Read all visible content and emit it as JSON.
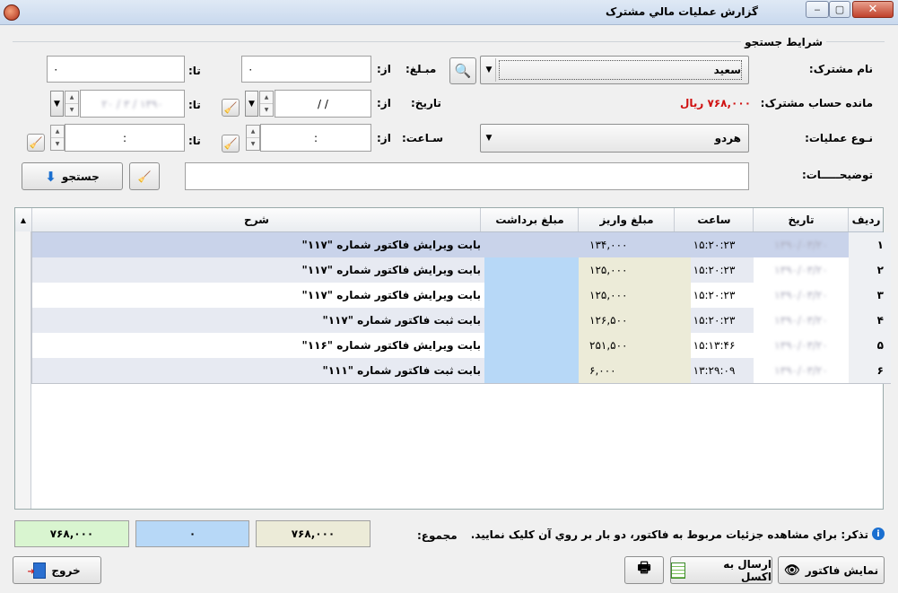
{
  "window": {
    "title": "گزارش عمليات مالي مشترک",
    "min": "‒",
    "restore": "▢",
    "close": "✕"
  },
  "search": {
    "group_title": "شرايط جستجو",
    "customer_label": "نام مشترک:",
    "customer_value": "سعيد",
    "balance_label": "مانده حساب مشترک:",
    "balance_value": "۷۶۸,۰۰۰ ريال",
    "optype_label": "نـوع عمليات:",
    "optype_value": "هردو",
    "desc_label": "توضيحـــــات:",
    "amount_label": "مبـلغ:",
    "from_label": "از:",
    "to_label": "تا:",
    "amount_from": "۰",
    "amount_to": "۰",
    "date_label": "تاريخ:",
    "date_from": "/   /",
    "date_to": "۱۳۹۰ / ۳ / ۲۰",
    "time_label": "سـاعت:",
    "time_from": ":",
    "time_to": ":",
    "search_button": "جستجو",
    "colors": {
      "balance": "#d01010"
    }
  },
  "table": {
    "headers": [
      "رديف",
      "تاريخ",
      "ساعت",
      "مبلغ واريز",
      "مبلغ برداشت",
      "شرح"
    ],
    "rows": [
      {
        "n": "۱",
        "date": "۱۳۹۰/۰۳/۲۰",
        "time": "۱۵:۲۰:۲۳",
        "deposit": "۱۳۴,۰۰۰",
        "withdraw": "",
        "desc": "بابت ويرايش فاکتور شماره \"۱۱۷\""
      },
      {
        "n": "۲",
        "date": "۱۳۹۰/۰۳/۲۰",
        "time": "۱۵:۲۰:۲۳",
        "deposit": "۱۲۵,۰۰۰",
        "withdraw": "",
        "desc": "بابت ويرايش فاکتور شماره \"۱۱۷\""
      },
      {
        "n": "۳",
        "date": "۱۳۹۰/۰۳/۲۰",
        "time": "۱۵:۲۰:۲۳",
        "deposit": "۱۲۵,۰۰۰",
        "withdraw": "",
        "desc": "بابت ويرايش فاکتور شماره \"۱۱۷\""
      },
      {
        "n": "۴",
        "date": "۱۳۹۰/۰۳/۲۰",
        "time": "۱۵:۲۰:۲۳",
        "deposit": "۱۲۶,۵۰۰",
        "withdraw": "",
        "desc": "بابت ثبت فاکتور شماره \"۱۱۷\""
      },
      {
        "n": "۵",
        "date": "۱۳۹۰/۰۳/۲۰",
        "time": "۱۵:۱۳:۴۶",
        "deposit": "۲۵۱,۵۰۰",
        "withdraw": "",
        "desc": "بابت ويرايش فاکتور شماره \"۱۱۶\""
      },
      {
        "n": "۶",
        "date": "۱۳۹۰/۰۳/۲۰",
        "time": "۱۳:۲۹:۰۹",
        "deposit": "۶,۰۰۰",
        "withdraw": "",
        "desc": "بابت ثبت فاکتور شماره \"۱۱۱\""
      }
    ]
  },
  "footer": {
    "note": "تذکر: براي مشاهده جزئيات مربوط به فاکتور، دو بار بر روي آن کليک نماييد.",
    "total_label": "مجموع:",
    "total_deposit": "۷۶۸,۰۰۰",
    "total_withdraw": "۰",
    "total_balance": "۷۶۸,۰۰۰",
    "show_invoice": "نمايش فاکتور",
    "export_excel": "ارسال به اکسل",
    "exit": "خروج",
    "colors": {
      "deposit": "#ecebd8",
      "withdraw": "#b7d8f7",
      "balance": "#d9f5d0"
    }
  }
}
